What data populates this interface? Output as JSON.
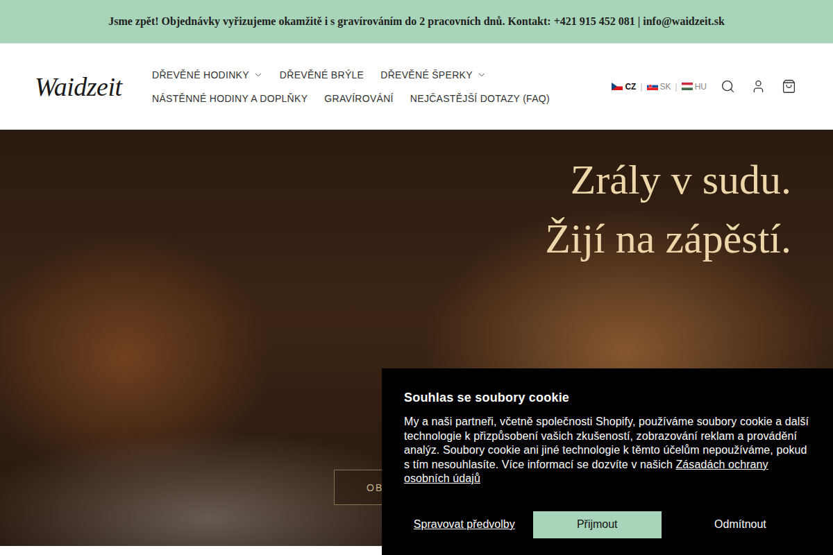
{
  "announcement": {
    "text": "Jsme zpět! Objednávky vyřizujeme okamžitě i s gravírováním do 2 pracovních dnů. Kontakt: +421 915 452 081 | info@waidzeit.sk"
  },
  "logo": {
    "text": "Waidzeit"
  },
  "nav": {
    "rows": [
      [
        {
          "label": "DŘEVĚNÉ HODINKY",
          "dropdown": true
        },
        {
          "label": "DŘEVĚNÉ BRÝLE",
          "dropdown": false
        },
        {
          "label": "DŘEVĚNÉ ŠPERKY",
          "dropdown": true
        }
      ],
      [
        {
          "label": "NÁSTĚNNÉ HODINY A DOPLŇKY",
          "dropdown": false
        },
        {
          "label": "GRAVÍROVÁNÍ",
          "dropdown": false
        },
        {
          "label": "NEJČASTĚJŠÍ DOTAZY (FAQ)",
          "dropdown": false
        }
      ]
    ]
  },
  "languages": {
    "separator": "|",
    "items": [
      {
        "code": "CZ",
        "selected": true
      },
      {
        "code": "SK",
        "selected": false
      },
      {
        "code": "HU",
        "selected": false
      }
    ]
  },
  "hero": {
    "lines": [
      "Zrály v sudu.",
      "Žijí na zápěstí."
    ],
    "button": "OB"
  },
  "cookie": {
    "title": "Souhlas se soubory cookie",
    "body": "My a naši partneři, včetně společnosti Shopify, používáme soubory cookie a další technologie k přizpůsobení vašich zkušeností, zobrazování reklam a provádění analýz. Soubory cookie ani jiné technologie k těmto účelům nepoužíváme, pokud s tím nesouhlasíte. Více informací se dozvíte v našich",
    "link": "Zásadách ochrany osobních údajů",
    "buttons": [
      {
        "label": "Spravovat předvolby",
        "kind": "link"
      },
      {
        "label": "Přijmout",
        "kind": "primary"
      },
      {
        "label": "Odmítnout",
        "kind": "plain"
      }
    ]
  }
}
